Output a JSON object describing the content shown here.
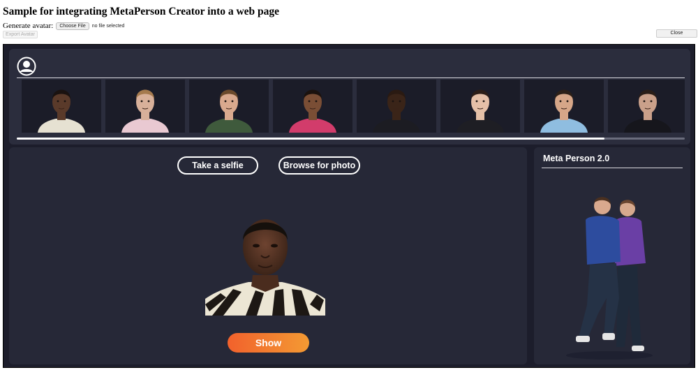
{
  "page": {
    "title": "Sample for integrating MetaPerson Creator into a web page",
    "generate_label": "Generate avatar:",
    "choose_file_label": "Choose File",
    "file_status": "no file selected",
    "export_label": "Export Avatar",
    "close_label": "Close"
  },
  "app": {
    "user_icon": "user-circle-icon",
    "avatars": [
      {
        "name": "avatar-1",
        "skin": "#5a3a2a",
        "hair": "#1a1210",
        "shirt": "#e6e1d2"
      },
      {
        "name": "avatar-2",
        "skin": "#d8b09a",
        "hair": "#a57a4e",
        "shirt": "#e9c9d2"
      },
      {
        "name": "avatar-3",
        "skin": "#d9a98e",
        "hair": "#6b4a2c",
        "shirt": "#3f5a3c"
      },
      {
        "name": "avatar-4",
        "skin": "#7a4e35",
        "hair": "#1b120e",
        "shirt": "#d23c6b"
      },
      {
        "name": "avatar-5",
        "skin": "#3a2418",
        "hair": "#2a1a12",
        "shirt": "#1c1c22"
      },
      {
        "name": "avatar-6",
        "skin": "#e5c0a8",
        "hair": "#2c1e18",
        "shirt": "#1e1e24"
      },
      {
        "name": "avatar-7",
        "skin": "#d6a688",
        "hair": "#2c2018",
        "shirt": "#8fbde0"
      },
      {
        "name": "avatar-8",
        "skin": "#caa08a",
        "hair": "#2a1e18",
        "shirt": "#16161c"
      }
    ],
    "take_selfie_label": "Take a selfie",
    "browse_label": "Browse for photo",
    "show_label": "Show",
    "panel_title": "Meta Person 2.0",
    "scroll_position": 0.88
  },
  "colors": {
    "accent_start": "#f2612c",
    "accent_end": "#f39a33",
    "frame_bg": "#1c1d2b",
    "panel_bg": "#262837"
  }
}
